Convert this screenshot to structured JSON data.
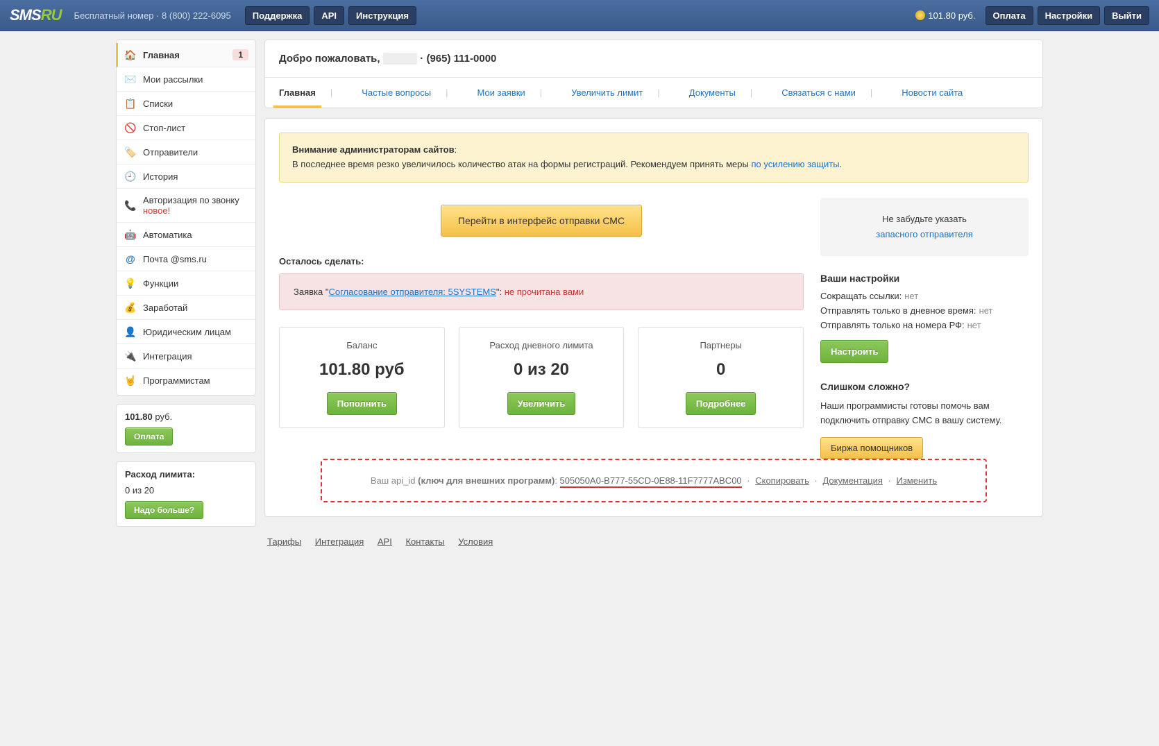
{
  "topbar": {
    "free_number_label": "Бесплатный номер",
    "phone": "8 (800) 222-6095",
    "support": "Поддержка",
    "api": "API",
    "instruction": "Инструкция",
    "balance": "101.80 руб.",
    "payment": "Оплата",
    "settings": "Настройки",
    "logout": "Выйти"
  },
  "sidebar": {
    "items": [
      {
        "label": "Главная",
        "badge": "1"
      },
      {
        "label": "Мои рассылки"
      },
      {
        "label": "Списки"
      },
      {
        "label": "Стоп-лист"
      },
      {
        "label": "Отправители"
      },
      {
        "label": "История"
      },
      {
        "label_pre": "Авторизация по звонку ",
        "label_new": "новое!"
      },
      {
        "label": "Автоматика"
      },
      {
        "label": "Почта @sms.ru"
      },
      {
        "label": "Функции"
      },
      {
        "label": "Заработай"
      },
      {
        "label": "Юридическим лицам"
      },
      {
        "label": "Интеграция"
      },
      {
        "label": "Программистам"
      }
    ],
    "balance_value": "101.80",
    "balance_unit": "руб.",
    "balance_btn": "Оплата",
    "limit_title": "Расход лимита:",
    "limit_value": "0 из 20",
    "limit_btn": "Надо больше?"
  },
  "main": {
    "welcome_prefix": "Добро пожаловать, ",
    "welcome_phone": " · (965) 111-0000",
    "tabs": [
      "Главная",
      "Частые вопросы",
      "Мои заявки",
      "Увеличить лимит",
      "Документы",
      "Связаться с нами",
      "Новости сайта"
    ],
    "notice": {
      "title": "Внимание администраторам сайтов",
      "text": "В последнее время резко увеличилось количество атак на формы регистраций. Рекомендуем принять меры ",
      "link": "по усилению защиты"
    },
    "cta": "Перейти в интерфейс отправки СМС",
    "todo_title": "Осталось сделать:",
    "request": {
      "label": "Заявка \"",
      "link": "Согласование отправителя: 5SYSTEMS",
      "after": "\": ",
      "status": "не прочитана вами"
    },
    "cards": [
      {
        "title": "Баланс",
        "value": "101.80 руб",
        "btn": "Пополнить"
      },
      {
        "title": "Расход дневного лимита",
        "value": "0 из 20",
        "btn": "Увеличить"
      },
      {
        "title": "Партнеры",
        "value": "0",
        "btn": "Подробнее"
      }
    ],
    "api": {
      "prefix": "Ваш api_id ",
      "bold": "(ключ для внешних программ)",
      "key": "505050A0-B777-55CD-0E88-11F7777ABC00",
      "copy": "Скопировать",
      "docs": "Документация",
      "change": "Изменить"
    }
  },
  "rightcol": {
    "reminder_text": "Не забудьте указать",
    "reminder_link": "запасного отправителя",
    "settings_title": "Ваши настройки",
    "settings": [
      {
        "label": "Сокращать ссылки:",
        "val": "нет"
      },
      {
        "label": "Отправлять только в дневное время:",
        "val": "нет"
      },
      {
        "label": "Отправлять только на номера РФ:",
        "val": "нет"
      }
    ],
    "settings_btn": "Настроить",
    "help_title": "Слишком сложно?",
    "help_text": "Наши программисты готовы помочь вам подключить отправку СМС в вашу систему.",
    "help_btn": "Биржа помощников"
  },
  "footer": {
    "links": [
      "Тарифы",
      "Интеграция",
      "API",
      "Контакты",
      "Условия"
    ]
  }
}
